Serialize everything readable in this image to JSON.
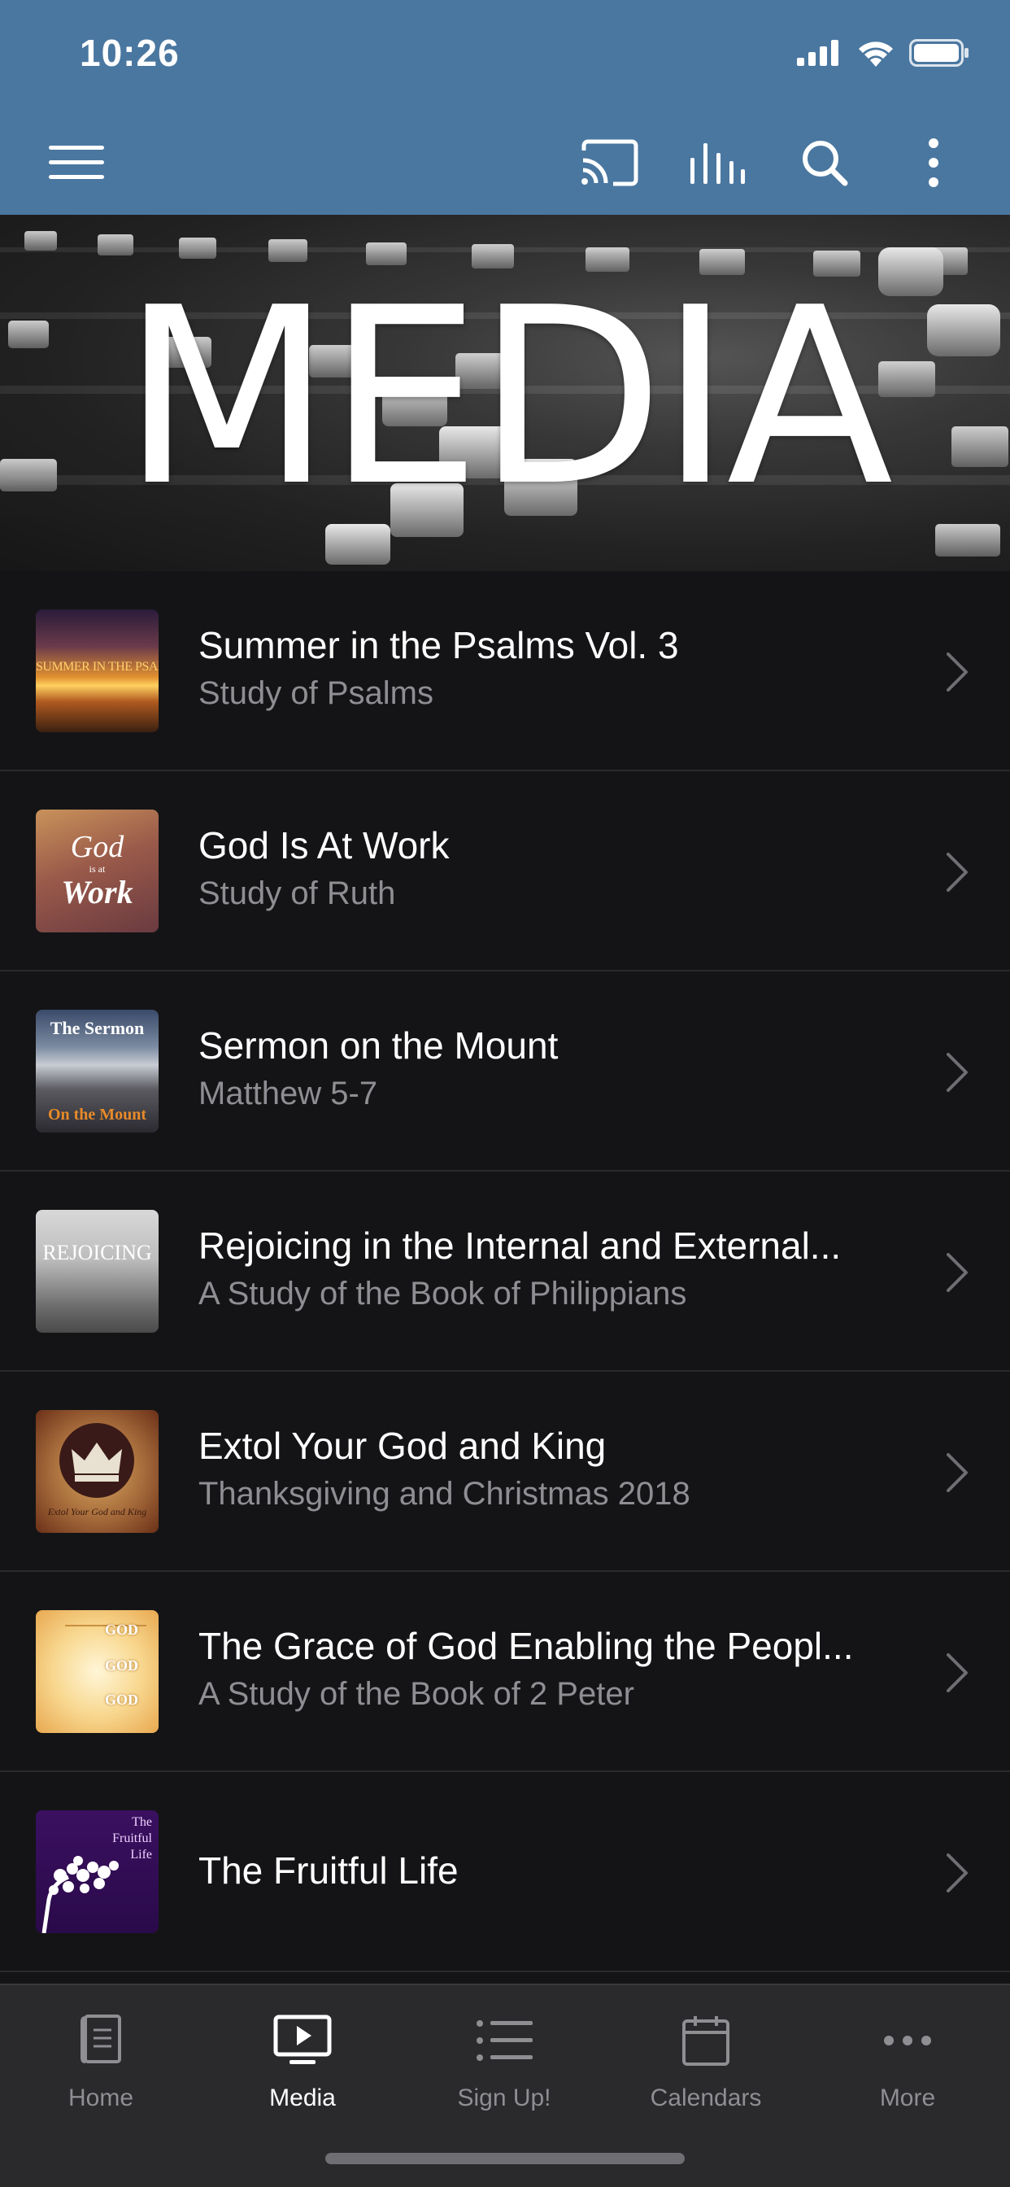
{
  "status_bar": {
    "time": "10:26"
  },
  "toolbar": {
    "menu_icon": "hamburger-menu-icon",
    "cast_icon": "cast-icon",
    "audio_icon": "equalizer-icon",
    "search_icon": "search-icon",
    "more_icon": "more-vertical-icon"
  },
  "banner": {
    "title": "MEDIA"
  },
  "media_items": [
    {
      "title": "Summer in the Psalms Vol. 3",
      "subtitle": "Study of Psalms",
      "thumb_text": "SUMMER IN THE PSALMS"
    },
    {
      "title": "God Is At Work",
      "subtitle": "Study of Ruth",
      "thumb_text_1": "God",
      "thumb_text_2": "is at",
      "thumb_text_3": "Work"
    },
    {
      "title": "Sermon on the Mount",
      "subtitle": "Matthew 5-7",
      "thumb_text_1": "The Sermon",
      "thumb_text_2": "On the Mount"
    },
    {
      "title": "Rejoicing in the Internal and External...",
      "subtitle": "A Study of the Book of Philippians",
      "thumb_text": "REJOICING"
    },
    {
      "title": "Extol Your God and King",
      "subtitle": "Thanksgiving and Christmas 2018",
      "thumb_text": "Extol Your God and King"
    },
    {
      "title": "The Grace of God Enabling the Peopl...",
      "subtitle": "A Study of the Book of 2 Peter",
      "thumb_text": "GOD"
    },
    {
      "title": "The Fruitful Life",
      "subtitle": "",
      "thumb_text_1": "The",
      "thumb_text_2": "Fruitful",
      "thumb_text_3": "Life"
    }
  ],
  "tabs": [
    {
      "label": "Home",
      "icon": "book-icon",
      "active": false
    },
    {
      "label": "Media",
      "icon": "play-screen-icon",
      "active": true
    },
    {
      "label": "Sign Up!",
      "icon": "list-icon",
      "active": false
    },
    {
      "label": "Calendars",
      "icon": "calendar-icon",
      "active": false
    },
    {
      "label": "More",
      "icon": "more-horizontal-icon",
      "active": false
    }
  ],
  "colors": {
    "header": "#4a77a0",
    "background": "#141416",
    "tabbar": "#2a2a2d",
    "subtitle": "#8e8e93"
  }
}
